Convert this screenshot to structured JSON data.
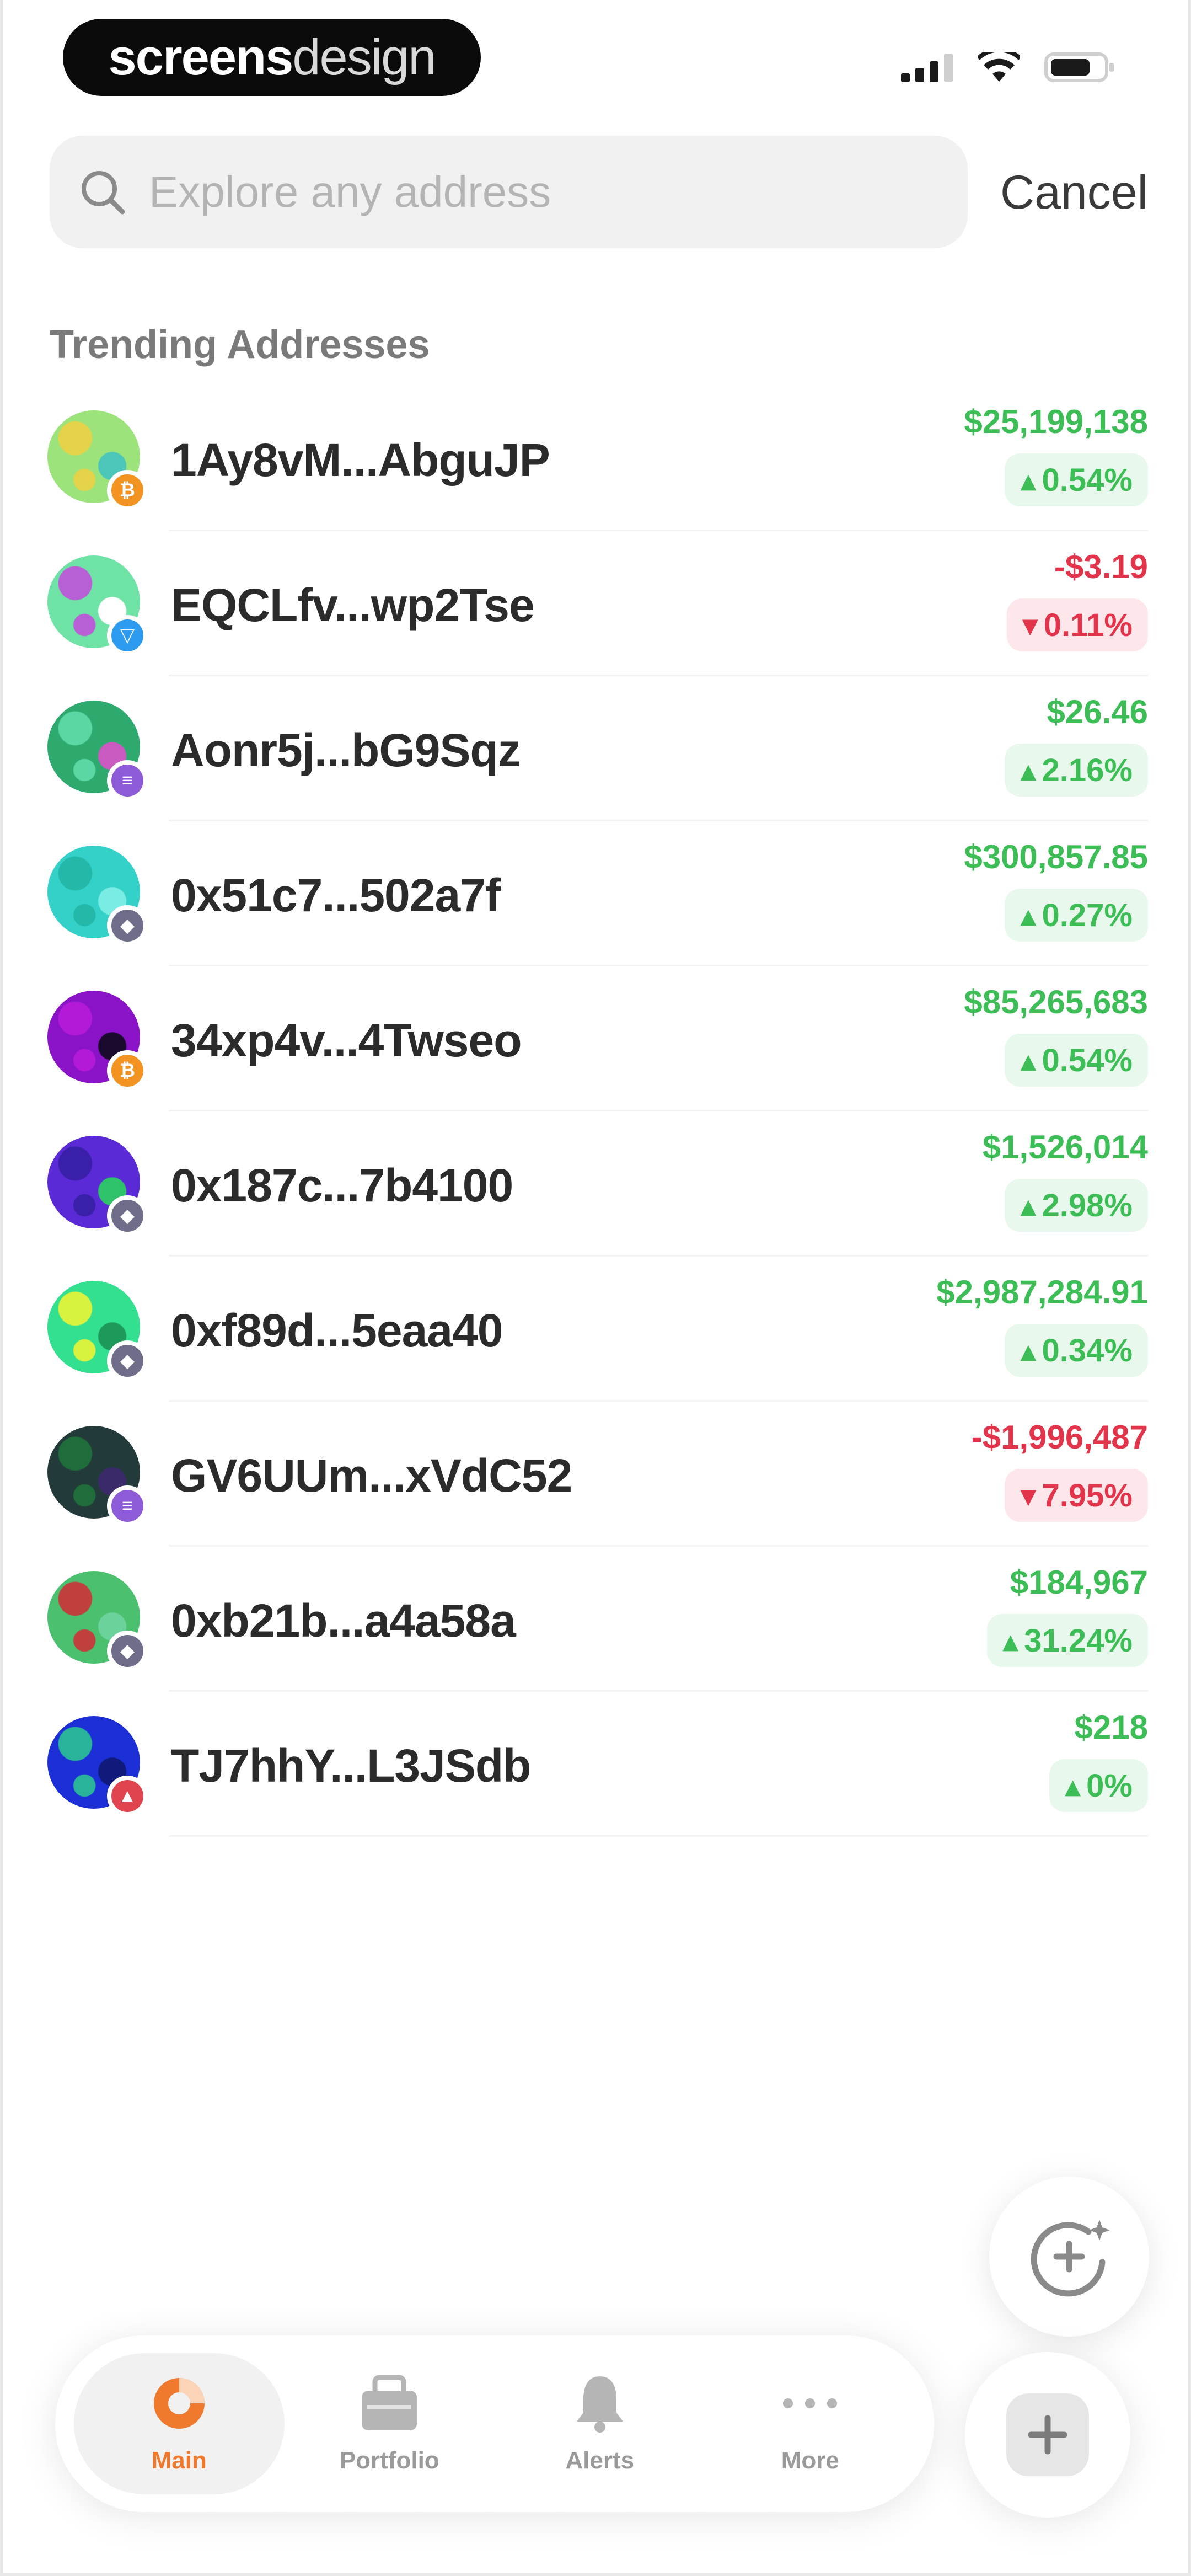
{
  "status_bar": {
    "brand_bold": "screens",
    "brand_light": "design",
    "icons": [
      "cellular-signal-icon",
      "wifi-icon",
      "battery-icon"
    ]
  },
  "search": {
    "placeholder": "Explore any address",
    "value": "",
    "cancel_label": "Cancel"
  },
  "section_title": "Trending Addresses",
  "colors": {
    "positive": "#3dbd55",
    "negative": "#e2344b",
    "accent": "#ef7a2e"
  },
  "addresses": [
    {
      "address": "1Ay8vM...AbguJP",
      "value": "$25,199,138",
      "change": "0.54%",
      "direction": "up",
      "chain": "bitcoin",
      "chain_icon": "bitcoin-icon",
      "avatar_colors": [
        "#9be37a",
        "#e4d349",
        "#4cc6b9"
      ]
    },
    {
      "address": "EQCLfv...wp2Tse",
      "value": "-$3.19",
      "change": "0.11%",
      "direction": "down",
      "chain": "toncoin",
      "chain_icon": "toncoin-icon",
      "avatar_colors": [
        "#6fe3a6",
        "#b85fd6",
        "#ffffff"
      ]
    },
    {
      "address": "Aonr5j...bG9Sqz",
      "value": "$26.46",
      "change": "2.16%",
      "direction": "up",
      "chain": "solana",
      "chain_icon": "solana-icon",
      "avatar_colors": [
        "#2faa6f",
        "#5ad7a2",
        "#c95ac0"
      ]
    },
    {
      "address": "0x51c7...502a7f",
      "value": "$300,857.85",
      "change": "0.27%",
      "direction": "up",
      "chain": "ethereum",
      "chain_icon": "ethereum-icon",
      "avatar_colors": [
        "#34d1c9",
        "#23b8a8",
        "#79ece3"
      ]
    },
    {
      "address": "34xp4v...4Twseo",
      "value": "$85,265,683",
      "change": "0.54%",
      "direction": "up",
      "chain": "bitcoin",
      "chain_icon": "bitcoin-icon",
      "avatar_colors": [
        "#8a13c7",
        "#b21ad8",
        "#1a0a2e"
      ]
    },
    {
      "address": "0x187c...7b4100",
      "value": "$1,526,014",
      "change": "2.98%",
      "direction": "up",
      "chain": "ethereum",
      "chain_icon": "ethereum-icon",
      "avatar_colors": [
        "#5a2ad6",
        "#3a1fa8",
        "#2ec26a"
      ]
    },
    {
      "address": "0xf89d...5eaa40",
      "value": "$2,987,284.91",
      "change": "0.34%",
      "direction": "up",
      "chain": "ethereum",
      "chain_icon": "ethereum-icon",
      "avatar_colors": [
        "#32e08f",
        "#d8f23e",
        "#1d9a5a"
      ]
    },
    {
      "address": "GV6UUm...xVdC52",
      "value": "-$1,996,487",
      "change": "7.95%",
      "direction": "down",
      "chain": "solana",
      "chain_icon": "solana-icon",
      "avatar_colors": [
        "#223a3a",
        "#1e6d3a",
        "#3a2a6a"
      ]
    },
    {
      "address": "0xb21b...a4a58a",
      "value": "$184,967",
      "change": "31.24%",
      "direction": "up",
      "chain": "ethereum",
      "chain_icon": "ethereum-icon",
      "avatar_colors": [
        "#4bc06f",
        "#c0403e",
        "#6ad29a"
      ]
    },
    {
      "address": "TJ7hhY...L3JSdb",
      "value": "$218",
      "change": "0%",
      "direction": "up",
      "chain": "tron",
      "chain_icon": "tron-icon",
      "avatar_colors": [
        "#1c2fd6",
        "#28b39a",
        "#0f1a7a"
      ]
    }
  ],
  "fab": {
    "icon": "ai-sparkle-icon"
  },
  "tabs": [
    {
      "label": "Main",
      "icon": "pie-chart-icon",
      "active": true
    },
    {
      "label": "Portfolio",
      "icon": "portfolio-icon",
      "active": false
    },
    {
      "label": "Alerts",
      "icon": "bell-icon",
      "active": false
    },
    {
      "label": "More",
      "icon": "more-dots-icon",
      "active": false
    }
  ],
  "add_button": {
    "icon": "plus-icon"
  }
}
